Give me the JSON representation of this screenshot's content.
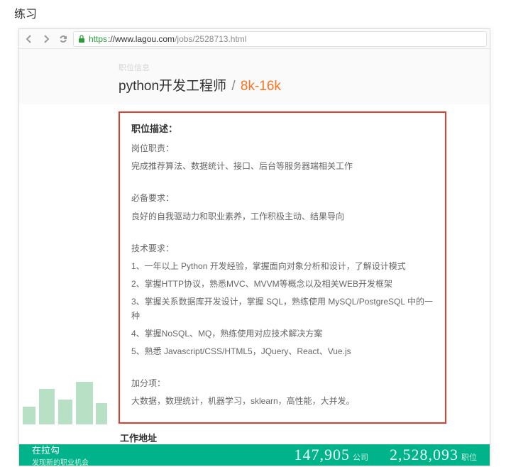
{
  "heading": "练习",
  "url": {
    "scheme": "https",
    "host": "://www.lagou.com",
    "path": "/jobs/2528713.html"
  },
  "breadcrumb": "职位信息",
  "job": {
    "title": "python开发工程师",
    "separator": "/",
    "salary": "8k-16k"
  },
  "description": {
    "heading": "职位描述：",
    "duty_label": "岗位职责：",
    "duty_text": "完成推荐算法、数据统计、接口、后台等服务器端相关工作",
    "must_label": "必备要求：",
    "must_text": "良好的自我驱动力和职业素养，工作积极主动、结果导向",
    "tech_label": "技术要求：",
    "tech": {
      "i1": "1、一年以上 Python 开发经验，掌握面向对象分析和设计，了解设计模式",
      "i2": "2、掌握HTTP协议，熟悉MVC、MVVM等概念以及相关WEB开发框架",
      "i3": "3、掌握关系数据库开发设计，掌握 SQL，熟练使用 MySQL/PostgreSQL 中的一种",
      "i4": "4、掌握NoSQL、MQ，熟练使用对应技术解决方案",
      "i5": "5、熟悉 Javascript/CSS/HTML5，JQuery、React、Vue.js"
    },
    "bonus_label": "加分项：",
    "bonus_text": "大数据，数理统计，机器学习，sklearn，高性能，大并发。"
  },
  "work_address_label": "工作地址",
  "bottom": {
    "brand_line1": "在拉勾",
    "brand_line2": "发现新的职业机会",
    "stat1_num": "147,905",
    "stat1_unit": "公司",
    "stat2_num": "2,528,093",
    "stat2_unit": "职位"
  }
}
